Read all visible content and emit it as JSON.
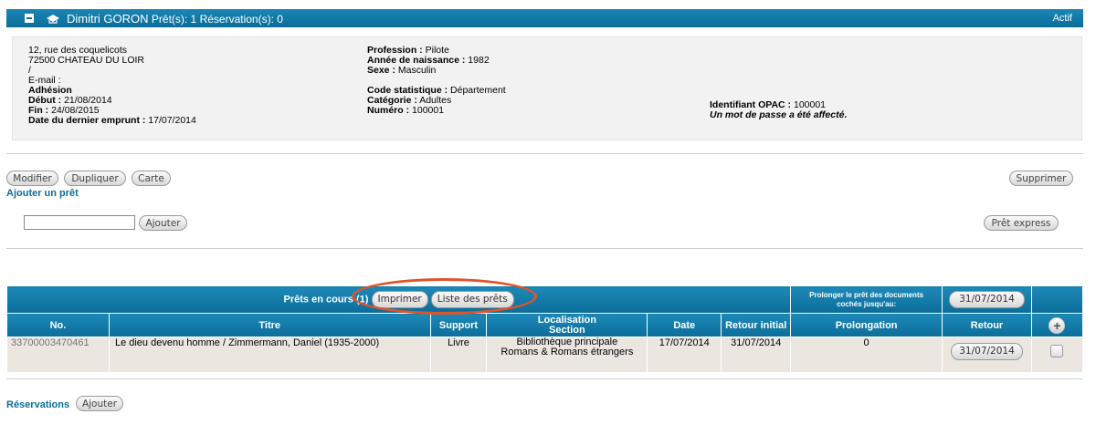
{
  "header": {
    "name": "Dimitri GORON",
    "counts": "Prêt(s): 1 Réservation(s): 0",
    "status": "Actif"
  },
  "address": {
    "line1": "12, rue des coquelicots",
    "line2": "72500 CHATEAU DU LOIR",
    "line3": "/",
    "email": "E-mail :",
    "adhesion": "Adhésion",
    "debut_label": "Début :",
    "debut": "21/08/2014",
    "fin_label": "Fin :",
    "fin": "24/08/2015",
    "dernier_label": "Date du dernier emprunt :",
    "dernier": "17/07/2014"
  },
  "profile": {
    "profession_label": "Profession :",
    "profession": "Pilote",
    "naissance_label": "Année de naissance :",
    "naissance": "1982",
    "sexe_label": "Sexe :",
    "sexe": "Masculin",
    "code_label": "Code statistique :",
    "code": "Département",
    "categorie_label": "Catégorie :",
    "categorie": "Adultes",
    "numero_label": "Numéro :",
    "numero": "100001"
  },
  "opac": {
    "label": "Identifiant OPAC :",
    "value": "100001",
    "note": "Un mot de passe a été affecté."
  },
  "actions": {
    "modifier": "Modifier",
    "dupliquer": "Dupliquer",
    "carte": "Carte",
    "supprimer": "Supprimer",
    "ajouter_pret": "Ajouter un prêt",
    "ajouter": "Ajouter",
    "pret_express": "Prêt express",
    "input_value": ""
  },
  "loans": {
    "title": "Prêts en cours",
    "count": "(1)",
    "imprimer": "Imprimer",
    "liste": "Liste des prêts",
    "prolonger_label": "Prolonger le prêt des documents cochés jusqu'au:",
    "prolonger_date": "31/07/2014",
    "columns": {
      "no": "No.",
      "titre": "Titre",
      "support": "Support",
      "loc1": "Localisation",
      "loc2": "Section",
      "date": "Date",
      "retour_initial": "Retour initial",
      "prolongation": "Prolongation",
      "retour": "Retour"
    },
    "rows": [
      {
        "no": "33700003470461",
        "titre": "Le dieu devenu homme / Zimmermann, Daniel (1935-2000)",
        "support": "Livre",
        "loc1": "Bibliothèque principale",
        "loc2": "Romans & Romans étrangers",
        "date": "17/07/2014",
        "retour_initial": "31/07/2014",
        "prolongation": "0",
        "retour": "31/07/2014"
      }
    ]
  },
  "reservations": {
    "label": "Réservations",
    "ajouter": "Ajouter"
  },
  "colors": {
    "header_blue": "#0b6d99",
    "link_blue": "#0b6d99",
    "highlight": "#e2532a"
  }
}
